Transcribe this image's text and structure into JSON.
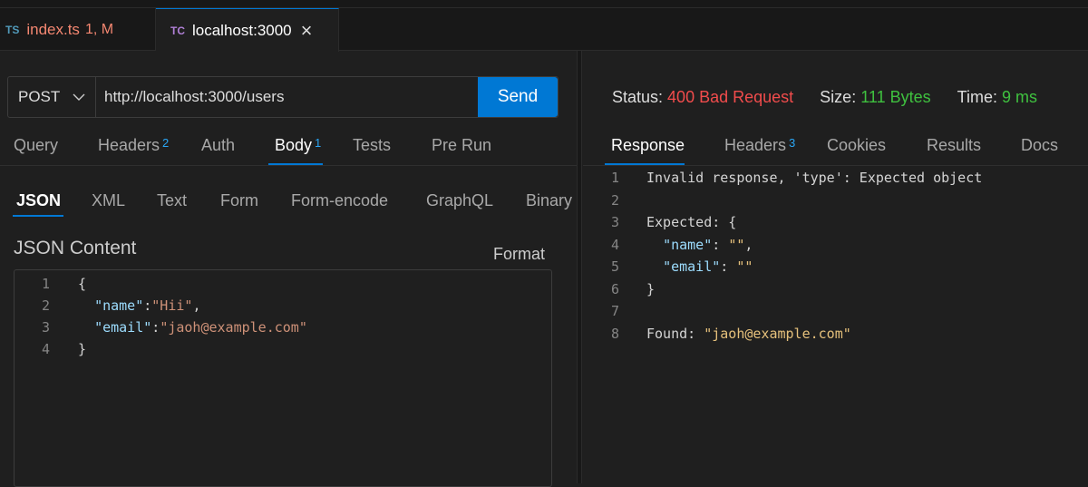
{
  "tabs": [
    {
      "icon": "TS",
      "label": "index.ts",
      "status": "1, M"
    },
    {
      "icon": "TC",
      "label": "localhost:3000",
      "close": "×"
    }
  ],
  "request": {
    "method": "POST",
    "url": "http://localhost:3000/users",
    "send": "Send",
    "tabs": [
      {
        "label": "Query"
      },
      {
        "label": "Headers",
        "count": "2"
      },
      {
        "label": "Auth"
      },
      {
        "label": "Body",
        "count": "1"
      },
      {
        "label": "Tests"
      },
      {
        "label": "Pre Run"
      }
    ],
    "body_tabs": [
      "JSON",
      "XML",
      "Text",
      "Form",
      "Form-encode",
      "GraphQL",
      "Binary"
    ],
    "content_label": "JSON Content",
    "format": "Format",
    "line_numbers": [
      "1",
      "2",
      "3",
      "4"
    ]
  },
  "response": {
    "status_label": "Status:",
    "status": "400 Bad Request",
    "size_label": "Size:",
    "size": "111 Bytes",
    "time_label": "Time:",
    "time": "9 ms",
    "tabs": [
      {
        "label": "Response"
      },
      {
        "label": "Headers",
        "count": "3"
      },
      {
        "label": "Cookies"
      },
      {
        "label": "Results"
      },
      {
        "label": "Docs"
      }
    ],
    "line_numbers": [
      "1",
      "2",
      "3",
      "4",
      "5",
      "6",
      "7",
      "8"
    ],
    "line1": "Invalid response, 'type': Expected object",
    "expected": "Expected: {",
    "found_label": "Found: ",
    "found_value": "\"jaoh@example.com\""
  },
  "colors": {
    "accent": "#0078d4",
    "error": "#f14c4c",
    "success": "#3fc13f"
  }
}
